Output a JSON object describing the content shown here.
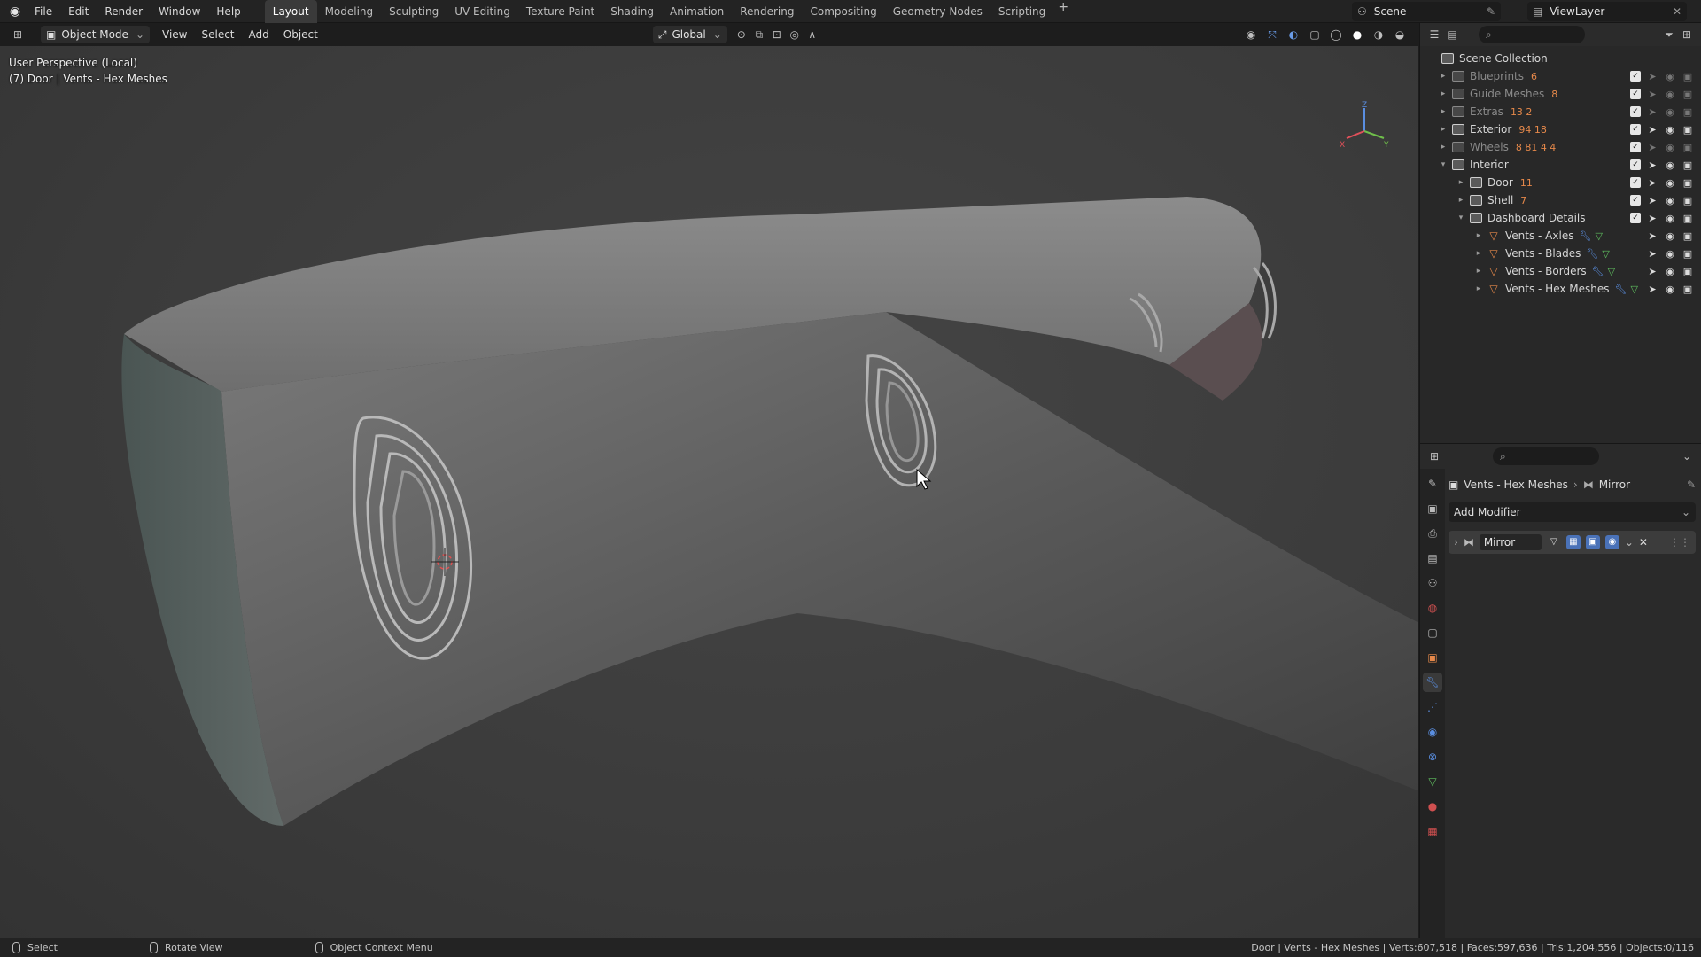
{
  "topbar": {
    "menus": [
      "File",
      "Edit",
      "Render",
      "Window",
      "Help"
    ],
    "workspaces": [
      "Layout",
      "Modeling",
      "Sculpting",
      "UV Editing",
      "Texture Paint",
      "Shading",
      "Animation",
      "Rendering",
      "Compositing",
      "Geometry Nodes",
      "Scripting"
    ],
    "active_workspace": "Layout",
    "scene": "Scene",
    "view_layer": "ViewLayer"
  },
  "viewport_header": {
    "mode": "Object Mode",
    "menus": [
      "View",
      "Select",
      "Add",
      "Object"
    ],
    "orientation": "Global"
  },
  "viewport": {
    "line1": "User Perspective (Local)",
    "line2": "(7) Door | Vents - Hex Meshes",
    "gizmo": {
      "x": "X",
      "y": "Y",
      "z": "Z"
    }
  },
  "outliner": {
    "root": "Scene Collection",
    "rows": [
      {
        "label": "Blueprints",
        "meta": "6",
        "dim": true,
        "indent": 0,
        "kind": "collection",
        "caret": "▸"
      },
      {
        "label": "Guide Meshes",
        "meta": "8",
        "dim": true,
        "indent": 0,
        "kind": "collection",
        "caret": "▸"
      },
      {
        "label": "Extras",
        "meta": "13 2",
        "dim": true,
        "indent": 0,
        "kind": "collection",
        "caret": "▸"
      },
      {
        "label": "Exterior",
        "meta": "94 18",
        "dim": false,
        "indent": 0,
        "kind": "collection",
        "caret": "▸"
      },
      {
        "label": "Wheels",
        "meta": "8 81 4 4",
        "dim": true,
        "indent": 0,
        "kind": "collection",
        "caret": "▸"
      },
      {
        "label": "Interior",
        "meta": "",
        "dim": false,
        "indent": 0,
        "kind": "collection",
        "caret": "▾"
      },
      {
        "label": "Door",
        "meta": "11",
        "dim": false,
        "indent": 1,
        "kind": "collection",
        "caret": "▸"
      },
      {
        "label": "Shell",
        "meta": "7",
        "dim": false,
        "indent": 1,
        "kind": "collection",
        "caret": "▸"
      },
      {
        "label": "Dashboard Details",
        "meta": "",
        "dim": false,
        "indent": 1,
        "kind": "collection",
        "caret": "▾"
      },
      {
        "label": "Vents - Axles",
        "meta": "",
        "dim": false,
        "indent": 2,
        "kind": "mesh",
        "caret": "▸"
      },
      {
        "label": "Vents - Blades",
        "meta": "",
        "dim": false,
        "indent": 2,
        "kind": "mesh",
        "caret": "▸"
      },
      {
        "label": "Vents - Borders",
        "meta": "",
        "dim": false,
        "indent": 2,
        "kind": "mesh",
        "caret": "▸"
      },
      {
        "label": "Vents - Hex Meshes",
        "meta": "",
        "dim": false,
        "indent": 2,
        "kind": "mesh",
        "caret": "▸"
      }
    ]
  },
  "properties": {
    "object": "Vents - Hex Meshes",
    "modifier_crumb": "Mirror",
    "add_modifier": "Add Modifier",
    "modifier_name": "Mirror"
  },
  "statusbar": {
    "select": "Select",
    "rotate": "Rotate View",
    "context": "Object Context Menu",
    "stats": "Door | Vents - Hex Meshes | Verts:607,518 | Faces:597,636 | Tris:1,204,556 | Objects:0/116"
  },
  "colors": {
    "accent": "#4a72b8",
    "mesh_orange": "#e5884a",
    "modifier_blue": "#5a8ee0",
    "data_green": "#5fc05f"
  }
}
